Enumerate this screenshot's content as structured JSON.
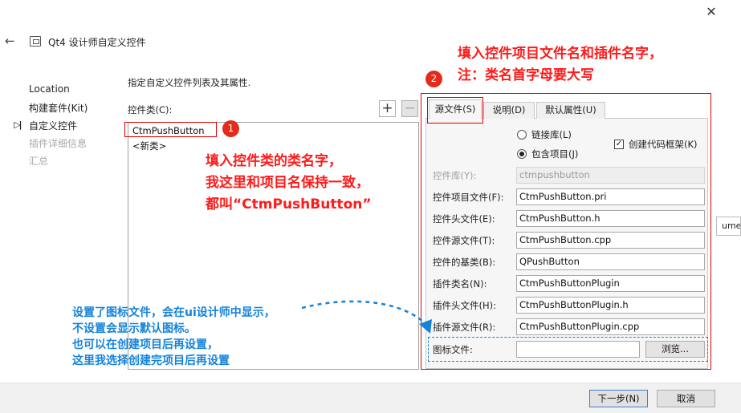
{
  "window": {
    "title": "Qt4 设计师自定义控件",
    "icons": {
      "close": "close-icon",
      "back": "back-arrow-icon",
      "wizard": "wizard-icon"
    }
  },
  "steps": [
    {
      "label": "Location",
      "state": "done"
    },
    {
      "label": "构建套件(Kit)",
      "state": "done"
    },
    {
      "label": "自定义控件",
      "state": "current"
    },
    {
      "label": "插件详细信息",
      "state": "pending"
    },
    {
      "label": "汇总",
      "state": "pending"
    }
  ],
  "main": {
    "description": "指定自定义控件列表及其属性.",
    "class_list_label": "控件类(C):",
    "add_button": "+",
    "remove_button": "−",
    "class_list_items": [
      "CtmPushButton",
      "<新类>"
    ]
  },
  "tabs": [
    {
      "label": "源文件(S)",
      "active": true
    },
    {
      "label": "说明(D)",
      "active": false
    },
    {
      "label": "默认属性(U)",
      "active": false
    }
  ],
  "source_tab": {
    "radio_link_library": {
      "label": "链接库(L)",
      "checked": false
    },
    "radio_include_project": {
      "label": "包含项目(J)",
      "checked": true
    },
    "checkbox_create_skeleton": {
      "label": "创建代码框架(K)",
      "checked": true
    },
    "fields": [
      {
        "label": "控件库(Y):",
        "value": "ctmpushbutton",
        "disabled": true
      },
      {
        "label": "控件项目文件(F):",
        "value": "CtmPushButton.pri",
        "disabled": false
      },
      {
        "label": "控件头文件(E):",
        "value": "CtmPushButton.h",
        "disabled": false
      },
      {
        "label": "控件源文件(T):",
        "value": "CtmPushButton.cpp",
        "disabled": false
      },
      {
        "label": "控件的基类(B):",
        "value": "QPushButton",
        "disabled": false
      },
      {
        "label": "插件类名(N):",
        "value": "CtmPushButtonPlugin",
        "disabled": false
      },
      {
        "label": "插件头文件(H):",
        "value": "CtmPushButtonPlugin.h",
        "disabled": false
      },
      {
        "label": "插件源文件(R):",
        "value": "CtmPushButtonPlugin.cpp",
        "disabled": false
      }
    ],
    "icon_file_label": "图标文件:",
    "icon_file_value": "",
    "browse_button": "浏览..."
  },
  "edge_input_text": "ume",
  "buttons": {
    "next": "下一步(N)",
    "cancel": "取消"
  },
  "annotations": {
    "badge_1": "1",
    "badge_2": "2",
    "note_right": [
      "填入控件项目文件名和插件名字，",
      "注：类名首字母要大写"
    ],
    "note_center": [
      "填入控件类的类名字，",
      "我这里和项目名保持一致，",
      "都叫“CtmPushButton”"
    ],
    "note_bottom": [
      "设置了图标文件，会在ui设计师中显示，",
      "不设置会显示默认图标。",
      "也可以在创建项目后再设置，",
      "这里我选择创建完项目后再设置"
    ],
    "red_color": "#ff1a1a",
    "blue_color": "#1583d9"
  }
}
